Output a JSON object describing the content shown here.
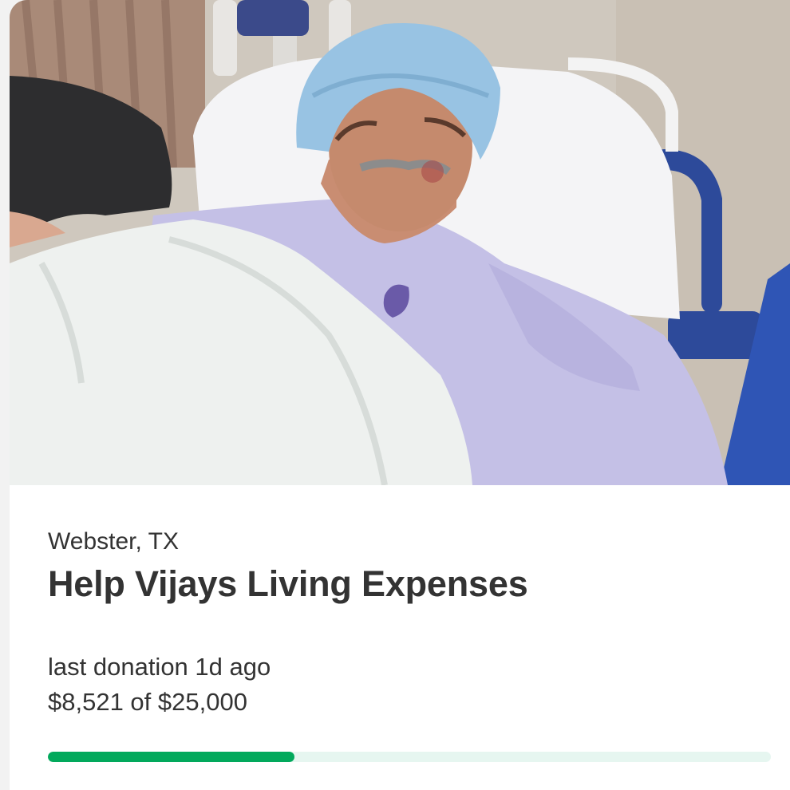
{
  "campaign": {
    "location": "Webster, TX",
    "title": "Help Vijays Living Expenses",
    "last_donation": "last donation 1d ago",
    "raised_text": "$8,521 of $25,000",
    "raised_amount": 8521,
    "goal_amount": 25000,
    "progress_fraction": 0.3408
  },
  "colors": {
    "accent": "#02a95c",
    "track": "#e6f6f0",
    "text": "#333333"
  }
}
